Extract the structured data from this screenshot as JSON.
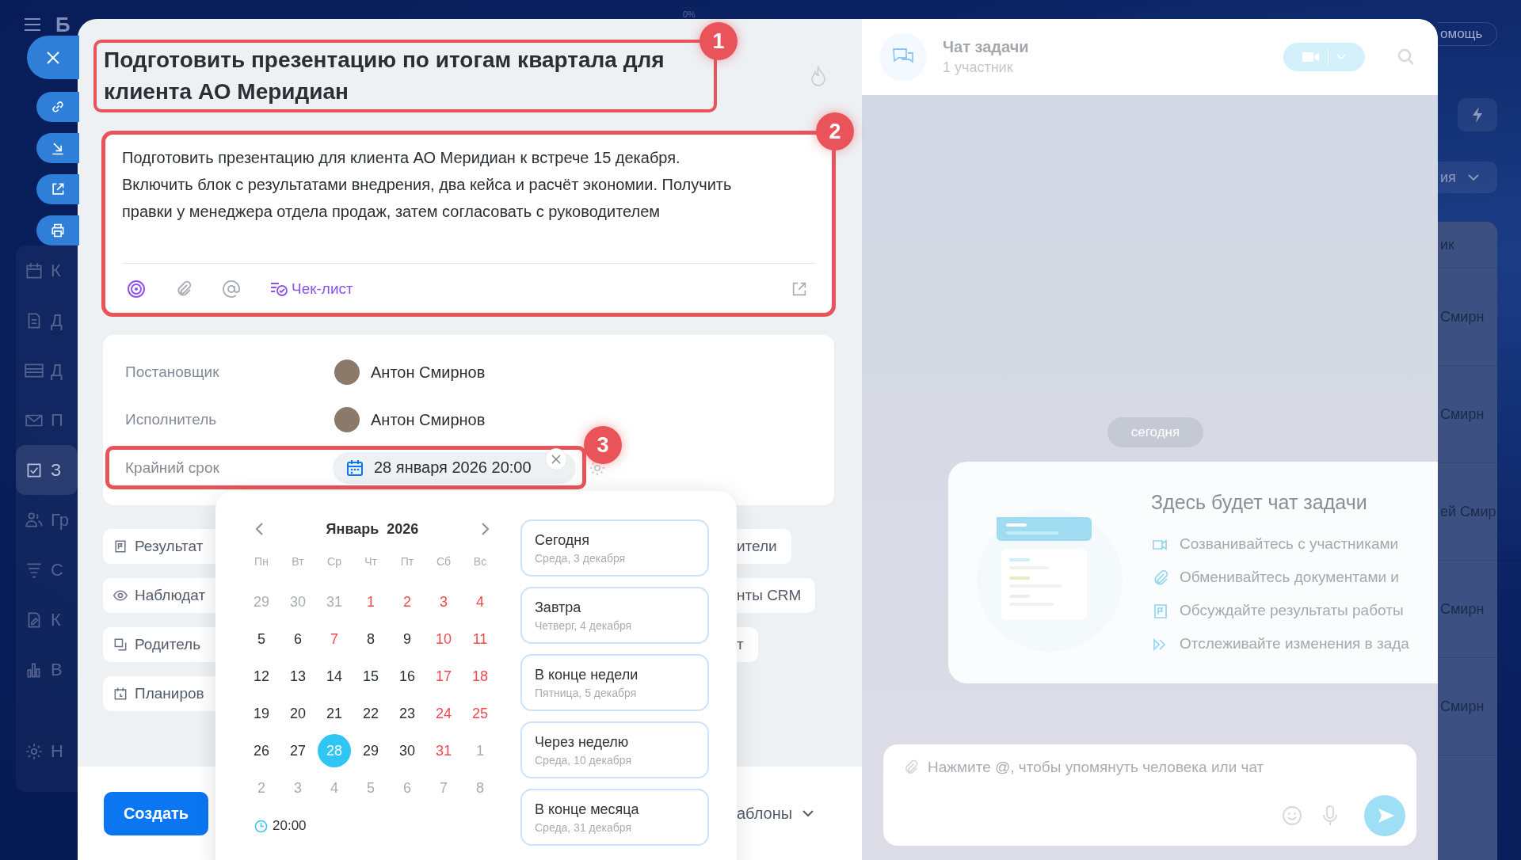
{
  "background_app": {
    "logo_letter": "Б",
    "progress": "0%",
    "help_button": "омощь",
    "view_dropdown": "ия",
    "sidebar_items": [
      {
        "label": "К",
        "selected": false
      },
      {
        "label": "Д",
        "selected": false
      },
      {
        "label": "Д",
        "selected": false
      },
      {
        "label": "П",
        "selected": false
      },
      {
        "label": "З",
        "selected": true
      },
      {
        "label": "Гр",
        "selected": false
      },
      {
        "label": "С",
        "selected": false
      },
      {
        "label": "К",
        "selected": false
      },
      {
        "label": "В",
        "selected": false
      },
      {
        "label": "Н",
        "selected": false
      }
    ],
    "list_header": "ик",
    "list_cells": [
      "Смирн",
      "Смирн",
      "ей Смир",
      "Смирн",
      "Смирн"
    ]
  },
  "task": {
    "title": "Подготовить презентацию по итогам квартала для клиента АО Меридиан",
    "title_callout": "1",
    "description": {
      "text": "Подготовить презентацию для клиента АО Меридиан к встрече 15 декабря.\nВключить блок с результатами внедрения, два кейса и расчёт экономии. Получить правки у менеджера отдела продаж, затем согласовать с руководителем",
      "callout": "2",
      "checklist": "Чек-лист"
    },
    "fields": [
      {
        "kind": "person",
        "label": "Постановщик",
        "value": "Антон Смирнов"
      },
      {
        "kind": "person",
        "label": "Исполнитель",
        "value": "Антон Смирнов"
      },
      {
        "kind": "date",
        "label": "Крайний срок",
        "value": "28 января 2026 20:00",
        "callout": "3"
      }
    ],
    "extra_rows": [
      {
        "left": "Результат",
        "right": "ители"
      },
      {
        "left": "Наблюдат",
        "right": "нты CRM"
      },
      {
        "left": "Родитель",
        "right": "т"
      },
      {
        "left": "Планиров"
      }
    ],
    "create_button": "Создать",
    "templates": "аблоны"
  },
  "date_picker": {
    "month": "Январь",
    "year": "2026",
    "weekdays": [
      "Пн",
      "Вт",
      "Ср",
      "Чт",
      "Пт",
      "Сб",
      "Вс"
    ],
    "weeks": [
      [
        {
          "label": "29",
          "kind": "other",
          "selected": false
        },
        {
          "label": "30",
          "kind": "other",
          "selected": false
        },
        {
          "label": "31",
          "kind": "other",
          "selected": false
        },
        {
          "label": "1",
          "kind": "holiday",
          "selected": false
        },
        {
          "label": "2",
          "kind": "holiday",
          "selected": false
        },
        {
          "label": "3",
          "kind": "holiday",
          "selected": false
        },
        {
          "label": "4",
          "kind": "holiday",
          "selected": false
        }
      ],
      [
        {
          "label": "5",
          "kind": "workday",
          "selected": false
        },
        {
          "label": "6",
          "kind": "workday",
          "selected": false
        },
        {
          "label": "7",
          "kind": "holiday",
          "selected": false
        },
        {
          "label": "8",
          "kind": "workday",
          "selected": false
        },
        {
          "label": "9",
          "kind": "workday",
          "selected": false
        },
        {
          "label": "10",
          "kind": "holiday",
          "selected": false
        },
        {
          "label": "11",
          "kind": "holiday",
          "selected": false
        }
      ],
      [
        {
          "label": "12",
          "kind": "workday",
          "selected": false
        },
        {
          "label": "13",
          "kind": "workday",
          "selected": false
        },
        {
          "label": "14",
          "kind": "workday",
          "selected": false
        },
        {
          "label": "15",
          "kind": "workday",
          "selected": false
        },
        {
          "label": "16",
          "kind": "workday",
          "selected": false
        },
        {
          "label": "17",
          "kind": "holiday",
          "selected": false
        },
        {
          "label": "18",
          "kind": "holiday",
          "selected": false
        }
      ],
      [
        {
          "label": "19",
          "kind": "workday",
          "selected": false
        },
        {
          "label": "20",
          "kind": "workday",
          "selected": false
        },
        {
          "label": "21",
          "kind": "workday",
          "selected": false
        },
        {
          "label": "22",
          "kind": "workday",
          "selected": false
        },
        {
          "label": "23",
          "kind": "workday",
          "selected": false
        },
        {
          "label": "24",
          "kind": "holiday",
          "selected": false
        },
        {
          "label": "25",
          "kind": "holiday",
          "selected": false
        }
      ],
      [
        {
          "label": "26",
          "kind": "workday",
          "selected": false
        },
        {
          "label": "27",
          "kind": "workday",
          "selected": false
        },
        {
          "label": "28",
          "kind": "workday",
          "selected": true
        },
        {
          "label": "29",
          "kind": "workday",
          "selected": false
        },
        {
          "label": "30",
          "kind": "workday",
          "selected": false
        },
        {
          "label": "31",
          "kind": "holiday",
          "selected": false
        },
        {
          "label": "1",
          "kind": "other",
          "selected": false
        }
      ],
      [
        {
          "label": "2",
          "kind": "other",
          "selected": false
        },
        {
          "label": "3",
          "kind": "other",
          "selected": false
        },
        {
          "label": "4",
          "kind": "other",
          "selected": false
        },
        {
          "label": "5",
          "kind": "other",
          "selected": false
        },
        {
          "label": "6",
          "kind": "other",
          "selected": false
        },
        {
          "label": "7",
          "kind": "other",
          "selected": false
        },
        {
          "label": "8",
          "kind": "other",
          "selected": false
        }
      ]
    ],
    "time": "20:00",
    "presets": [
      {
        "title": "Сегодня",
        "subtitle": "Среда, 3 декабря"
      },
      {
        "title": "Завтра",
        "subtitle": "Четверг, 4 декабря"
      },
      {
        "title": "В конце недели",
        "subtitle": "Пятница, 5 декабря"
      },
      {
        "title": "Через неделю",
        "subtitle": "Среда, 10 декабря"
      },
      {
        "title": "В конце месяца",
        "subtitle": "Среда, 31 декабря"
      }
    ]
  },
  "chat": {
    "title": "Чат задачи",
    "subtitle": "1 участник",
    "date_chip": "сегодня",
    "welcome": {
      "title": "Здесь будет чат задачи",
      "features": [
        "Созванивайтесь с участниками",
        "Обменивайтесь документами и",
        "Обсуждайте результаты работы",
        "Отслеживайте изменения в зада"
      ]
    },
    "input": {
      "placeholder": "Нажмите @, чтобы упомянуть человека или чат"
    }
  }
}
